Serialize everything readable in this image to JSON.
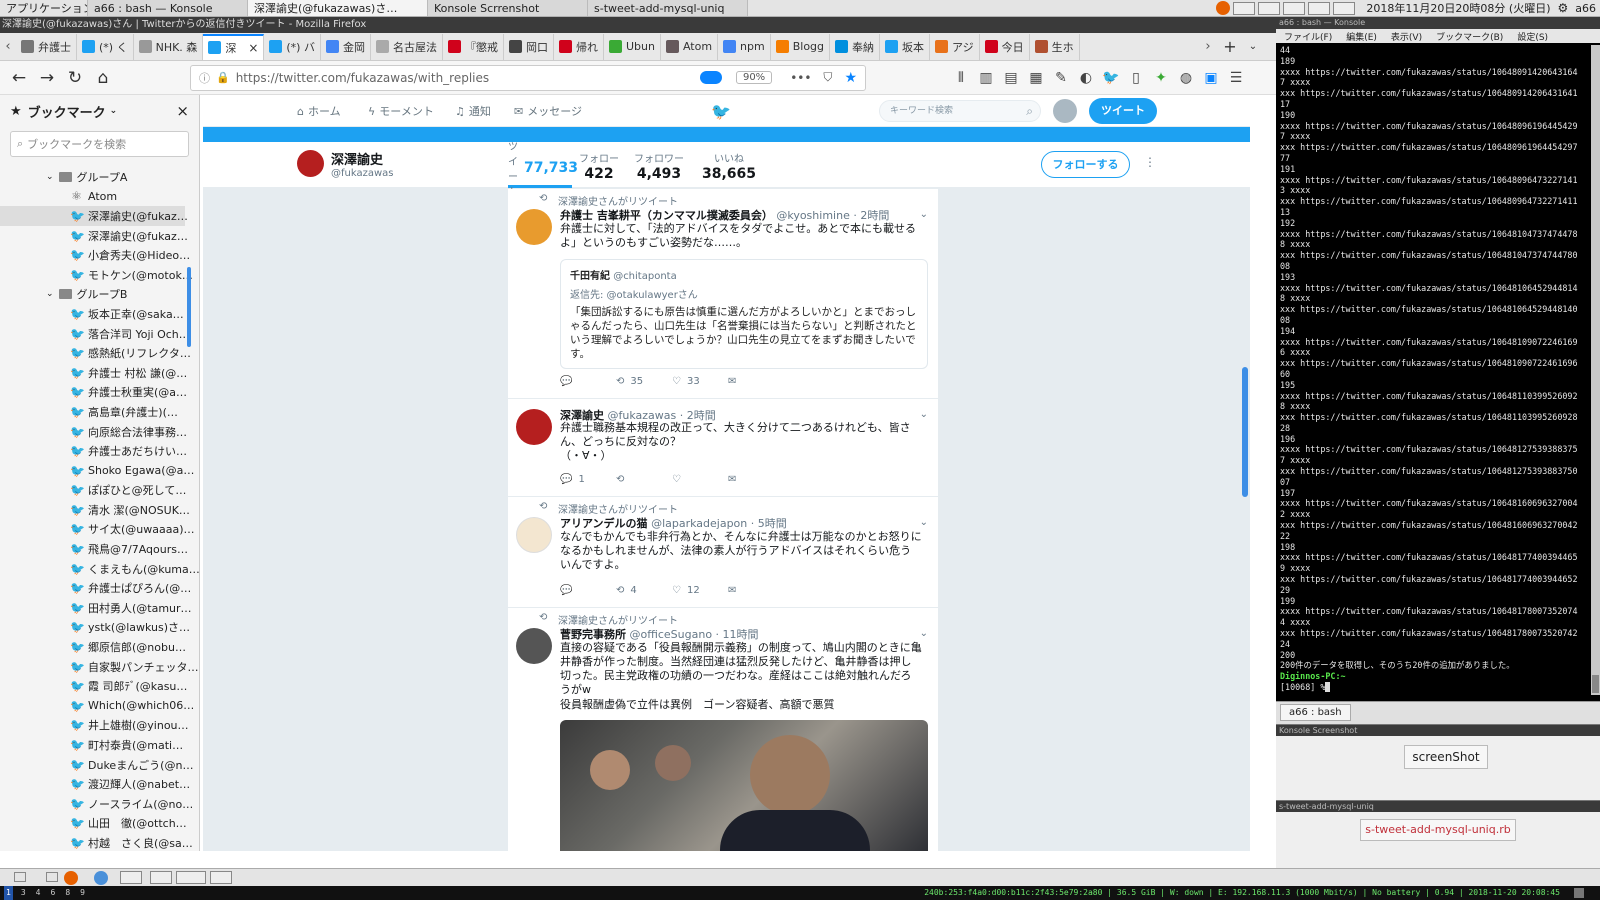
{
  "top_panel": {
    "app_menu": "アプリケーション",
    "tasks": [
      "a66 : bash — Konsole",
      "深澤諭史(@fukazawas)さ…",
      "Konsole Scrrenshot",
      "s-tweet-add-mysql-uniq"
    ],
    "clock": "2018年11月20日20時08分 (火曜日)",
    "user": "a66"
  },
  "firefox": {
    "window_title": "深澤諭史(@fukazawas)さん | Twitterからの返信付きツイート - Mozilla Firefox",
    "tabs": [
      {
        "label": "弁護士",
        "icon": "page-icon",
        "color": "#777777"
      },
      {
        "label": "(*) く",
        "icon": "twitter-icon",
        "color": "#1da1f2"
      },
      {
        "label": "NHK. 森",
        "icon": "page-icon",
        "color": "#999999"
      },
      {
        "label": "深",
        "icon": "twitter-icon",
        "color": "#1da1f2"
      },
      {
        "label": "(*) バ",
        "icon": "twitter-icon",
        "color": "#1da1f2"
      },
      {
        "label": "金岡",
        "icon": "google-icon",
        "color": "#4285f4"
      },
      {
        "label": "名古屋法",
        "icon": "page-icon",
        "color": "#aaaaaa"
      },
      {
        "label": "『懲戒",
        "icon": "yahoo-icon",
        "color": "#d0021b"
      },
      {
        "label": "岡口",
        "icon": "blog-icon",
        "color": "#444444"
      },
      {
        "label": "帰れ",
        "icon": "yahoo-icon",
        "color": "#d0021b"
      },
      {
        "label": "Ubun",
        "icon": "green-icon",
        "color": "#3aaa35"
      },
      {
        "label": "Atom",
        "icon": "atom-icon",
        "color": "#66595c"
      },
      {
        "label": "npm",
        "icon": "google-icon",
        "color": "#4285f4"
      },
      {
        "label": "Blogg",
        "icon": "blogger-icon",
        "color": "#f57d00"
      },
      {
        "label": "奉納",
        "icon": "hatena-icon",
        "color": "#008fde"
      },
      {
        "label": "坂本",
        "icon": "twitter-icon",
        "color": "#1da1f2"
      },
      {
        "label": "アジ",
        "icon": "orange-icon",
        "color": "#e8711a"
      },
      {
        "label": "今日",
        "icon": "yahoo-icon",
        "color": "#d0021b"
      },
      {
        "label": "生ホ",
        "icon": "page-icon",
        "color": "#b05030"
      }
    ],
    "url": "https://twitter.com/fukazawas/with_replies",
    "zoom": "90%"
  },
  "sidebar": {
    "title": "ブックマーク",
    "search_placeholder": "ブックマークを検索",
    "groupA": "グループA",
    "groupA_items": [
      "Atom",
      "深澤諭史(@fukaz…",
      "深澤諭史(@fukaz…",
      "小倉秀夫(@Hideo…",
      "モトケン(@motok…"
    ],
    "groupB": "グループB",
    "groupB_items": [
      "坂本正幸(@saka…",
      "落合洋司 Yoji Och…",
      "感熱紙(リフレクタ…",
      "弁護士 村松 謙(@…",
      "弁護士秋重実(@a…",
      "高島章(弁護士)(…",
      "向原総合法律事務…",
      "弁護士あだちけい…",
      "Shoko Egawa(@a…",
      "ぽぽひと@死して…",
      "清水 潔(@NOSUK…",
      "サイ太(@uwaaaa)…",
      "飛鳥@7/7Aqours…",
      "くまえもん(@kuma…",
      "弁護士ぱぴろん(@…",
      "田村勇人(@tamur…",
      "ystk(@lawkus)さ…",
      "郷原信郎(@nobu…",
      "自家製パンチェッタ…",
      "霞 司郎ﾃﾞ(@kasu…",
      "Which(@which06…",
      "井上雄樹(@yinou…",
      "町村泰貴(@mati…",
      "Dukeまんごう(@n…",
      "渡辺輝人(@nabet…",
      "ノースライム(@no…",
      "山田　徹(@ottch…",
      "村越　さく良(@sa…"
    ]
  },
  "twitter": {
    "nav": {
      "home": "ホーム",
      "moments": "モーメント",
      "notifications": "通知",
      "messages": "メッセージ",
      "search_placeholder": "キーワード検索",
      "tweet_button": "ツイート"
    },
    "profile": {
      "name": "深澤諭史",
      "handle": "@fukazawas",
      "follow_button": "フォローする"
    },
    "stats": [
      {
        "label": "ツイート",
        "value": "77,733"
      },
      {
        "label": "フォロー",
        "value": "422"
      },
      {
        "label": "フォロワー",
        "value": "4,493"
      },
      {
        "label": "いいね",
        "value": "38,665"
      }
    ],
    "tweets": [
      {
        "context": "深澤諭史さんがリツイート",
        "name": "弁護士 吉峯耕平（カンママル撲滅委員会）",
        "meta": "@kyoshimine · 2時間",
        "text": "弁護士に対して、「法的アドバイスをタダでよこせ。あとで本にも載せるよ」というのもすごい姿勢だな……。",
        "quote_name": "千田有紀",
        "quote_handle": "@chitaponta",
        "quote_reply": "返信先: @otakulawyerさん",
        "quote_text": "「集団訴訟するにも原告は慎重に選んだ方がよろしいかと」とまでおっしゃるんだったら、山口先生は「名誉棄損には当たらない」と判断されたという理解でよろしいでしょうか？山口先生の見立てをまずお聞きしたいです。",
        "retweets": "35",
        "likes": "33"
      },
      {
        "name": "深澤諭史",
        "meta": "@fukazawas · 2時間",
        "text": "弁護士職務基本規程の改正って、大きく分けて二つあるけれども、皆さん、どっちに反対なの？",
        "text2": "（・∀・）",
        "replies": "1"
      },
      {
        "context": "深澤諭史さんがリツイート",
        "name": "アリアンデルの猫",
        "meta": "@laparkadejapon · 5時間",
        "text": "なんでもかんでも非弁行為とか、そんなに弁護士は万能なのかとお怒りになるかもしれませんが、法律の素人が行うアドバイスはそれくらい危ういんですよ。",
        "retweets": "4",
        "likes": "12"
      },
      {
        "context": "深澤諭史さんがリツイート",
        "name": "菅野完事務所",
        "meta": "@officeSugano · 11時間",
        "text": "直接の容疑である「役員報酬開示義務」の制度って、鳩山内閣のときに亀井静香が作った制度。当然経団連は猛烈反発したけど、亀井静香は押し切った。民主党政権の功績の一つだわな。産経はここは絶対触れんだろうがw",
        "text2": "役員報酬虚偽で立件は異例　ゴーン容疑者、高額で悪質"
      }
    ]
  },
  "konsole": {
    "title": "a66 : bash — Konsole",
    "menu": [
      "ファイル(F)",
      "編集(E)",
      "表示(V)",
      "ブックマーク(B)",
      "設定(S)"
    ],
    "lines": "44\n189\nxxxx https://twitter.com/fukazawas/status/10648091420643164\n7 xxxx\nxxx https://twitter.com/fukazawas/status/106480914206431641\n17\n190\nxxxx https://twitter.com/fukazawas/status/10648096196445429\n7 xxxx\nxxx https://twitter.com/fukazawas/status/106480961964454297\n77\n191\nxxxx https://twitter.com/fukazawas/status/10648096473227141\n3 xxxx\nxxx https://twitter.com/fukazawas/status/106480964732271411\n13\n192\nxxxx https://twitter.com/fukazawas/status/10648104737474478\n8 xxxx\nxxx https://twitter.com/fukazawas/status/106481047374744780\n08\n193\nxxxx https://twitter.com/fukazawas/status/10648106452944814\n8 xxxx\nxxx https://twitter.com/fukazawas/status/106481064529448140\n08\n194\nxxxx https://twitter.com/fukazawas/status/10648109072246169\n6 xxxx\nxxx https://twitter.com/fukazawas/status/106481090722461696\n60\n195\nxxxx https://twitter.com/fukazawas/status/10648110399526092\n8 xxxx\nxxx https://twitter.com/fukazawas/status/106481103995260928\n28\n196\nxxxx https://twitter.com/fukazawas/status/10648127539388375\n7 xxxx\nxxx https://twitter.com/fukazawas/status/106481275393883750\n07\n197\nxxxx https://twitter.com/fukazawas/status/10648160696327004\n2 xxxx\nxxx https://twitter.com/fukazawas/status/106481606963270042\n22\n198\nxxxx https://twitter.com/fukazawas/status/10648177400394465\n9 xxxx\nxxx https://twitter.com/fukazawas/status/106481774003944652\n29\n199\nxxxx https://twitter.com/fukazawas/status/10648178007352074\n4 xxxx\nxxx https://twitter.com/fukazawas/status/106481780073520742\n24\n200\n200件のデータを取得し、そのうち20件の追加がありました。",
    "prompt": "Diginnos-PC:~",
    "prompt2": "[10068] %",
    "tab": "a66 : bash"
  },
  "screenshot_panel": {
    "title": "Konsole Screenshot",
    "button": "screenShot"
  },
  "mysql_panel": {
    "title": "s-tweet-add-mysql-uniq",
    "button": "s-tweet-add-mysql-uniq.rb"
  },
  "status_bar": {
    "workspaces": [
      "1",
      "3",
      "4",
      "6",
      "8",
      "9"
    ],
    "text": "240b:253:f4a0:d00:b11c:2f43:5e79:2a80 | 36.5 GiB | W: down | E: 192.168.11.3 (1000 Mbit/s) | No battery | 0.94 | 2018-11-20 20:08:45"
  }
}
